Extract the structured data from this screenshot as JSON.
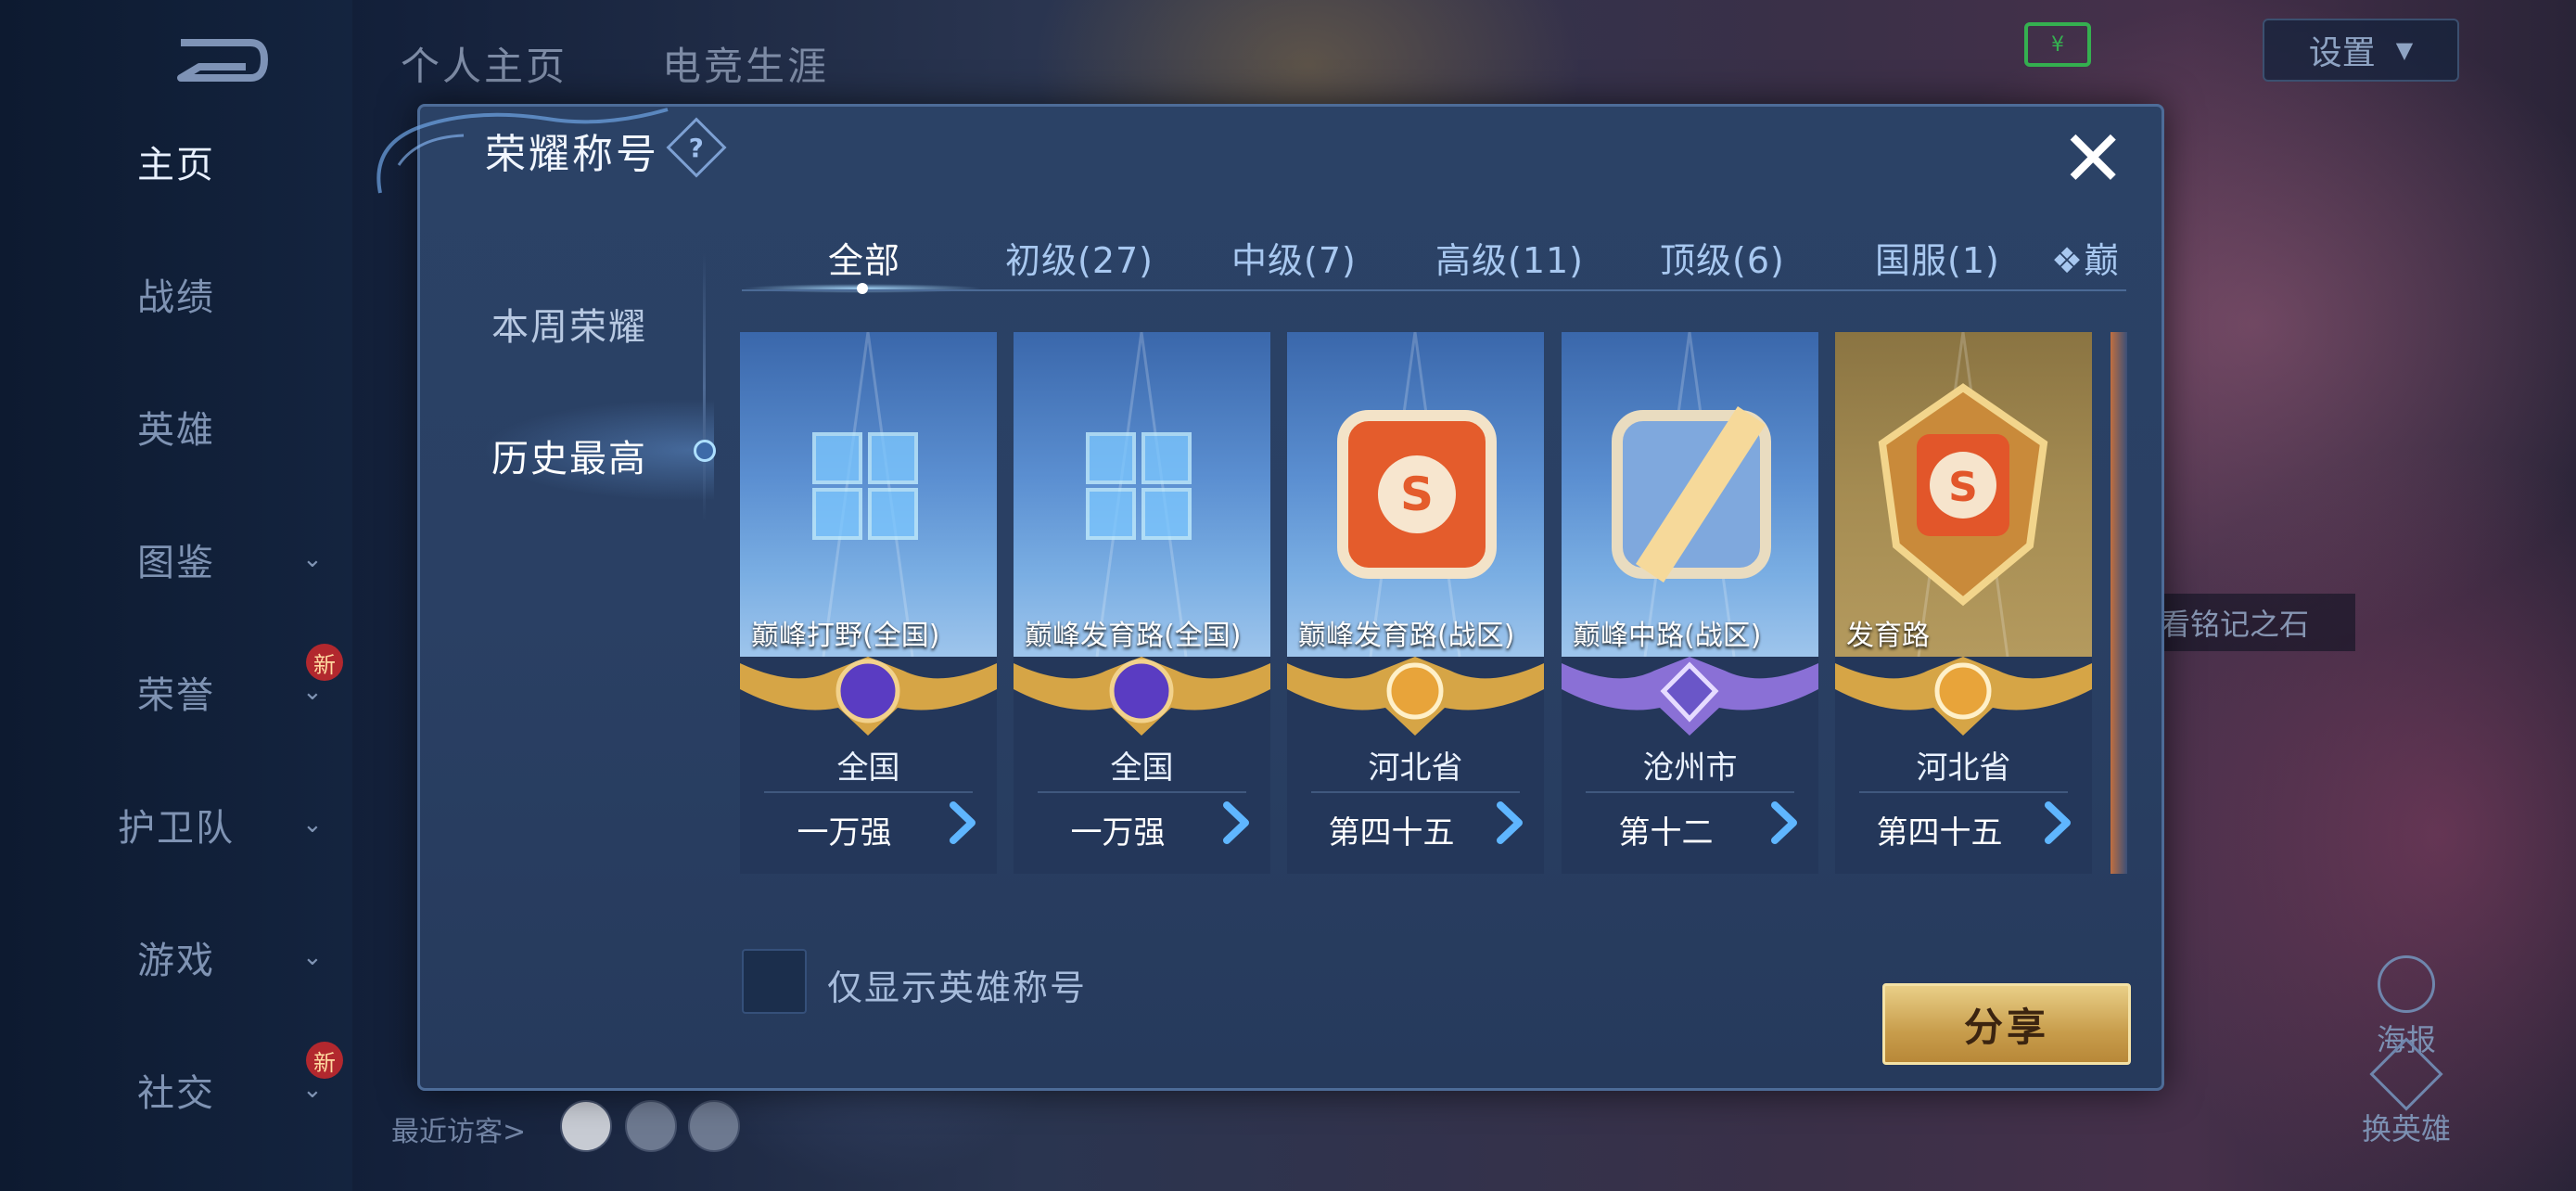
{
  "left_nav": {
    "items": [
      {
        "label": "主页",
        "active": true,
        "chevron": false,
        "badge": ""
      },
      {
        "label": "战绩",
        "active": false,
        "chevron": false,
        "badge": ""
      },
      {
        "label": "英雄",
        "active": false,
        "chevron": false,
        "badge": ""
      },
      {
        "label": "图鉴",
        "active": false,
        "chevron": true,
        "badge": ""
      },
      {
        "label": "荣誉",
        "active": false,
        "chevron": true,
        "badge": "新"
      },
      {
        "label": "护卫队",
        "active": false,
        "chevron": true,
        "badge": ""
      },
      {
        "label": "游戏",
        "active": false,
        "chevron": true,
        "badge": ""
      },
      {
        "label": "社交",
        "active": false,
        "chevron": true,
        "badge": "新"
      }
    ]
  },
  "top_tabs": [
    "个人主页",
    "电竞生涯"
  ],
  "top_right": {
    "settings_label": "设置"
  },
  "right_side": {
    "stone_label": "看铭记之石",
    "poster_label": "海报",
    "change_hero_label": "换英雄"
  },
  "visitors_label": "最近访客>",
  "modal": {
    "title": "荣耀称号",
    "help_symbol": "?",
    "close_symbol": "✕",
    "side_tabs": [
      {
        "label": "本周荣耀",
        "active": false
      },
      {
        "label": "历史最高",
        "active": true
      }
    ],
    "category_tabs": [
      {
        "label": "全部",
        "active": true
      },
      {
        "label": "初级(27)",
        "active": false
      },
      {
        "label": "中级(7)",
        "active": false
      },
      {
        "label": "高级(11)",
        "active": false
      },
      {
        "label": "顶级(6)",
        "active": false
      },
      {
        "label": "国服(1)",
        "active": false
      },
      {
        "label": "❖巅",
        "active": false
      }
    ],
    "cards": [
      {
        "name": "巅峰打野(全国)",
        "region": "全国",
        "rank": "一万强",
        "emblem": "grid-emblem",
        "wing": "purple-crest-gold-wing"
      },
      {
        "name": "巅峰发育路(全国)",
        "region": "全国",
        "rank": "一万强",
        "emblem": "grid-emblem",
        "wing": "purple-crest-gold-wing"
      },
      {
        "name": "巅峰发育路(战区)",
        "region": "河北省",
        "rank": "第四十五",
        "emblem": "square-s-emblem",
        "wing": "gold-crest-wing"
      },
      {
        "name": "巅峰中路(战区)",
        "region": "沧州市",
        "rank": "第十二",
        "emblem": "square-slash-emblem",
        "wing": "purple-crest-wing"
      },
      {
        "name": "发育路",
        "region": "河北省",
        "rank": "第四十五",
        "emblem": "shield-s-emblem",
        "wing": "gold-crest-wing"
      }
    ],
    "filter_checkbox": {
      "label": "仅显示英雄称号",
      "checked": false
    },
    "share_label": "分享"
  },
  "colors": {
    "accent_gold": "#c89d4c",
    "panel": "#2a4064",
    "tab_active": "#ffffff",
    "tab_inactive": "#a8c8f0"
  }
}
